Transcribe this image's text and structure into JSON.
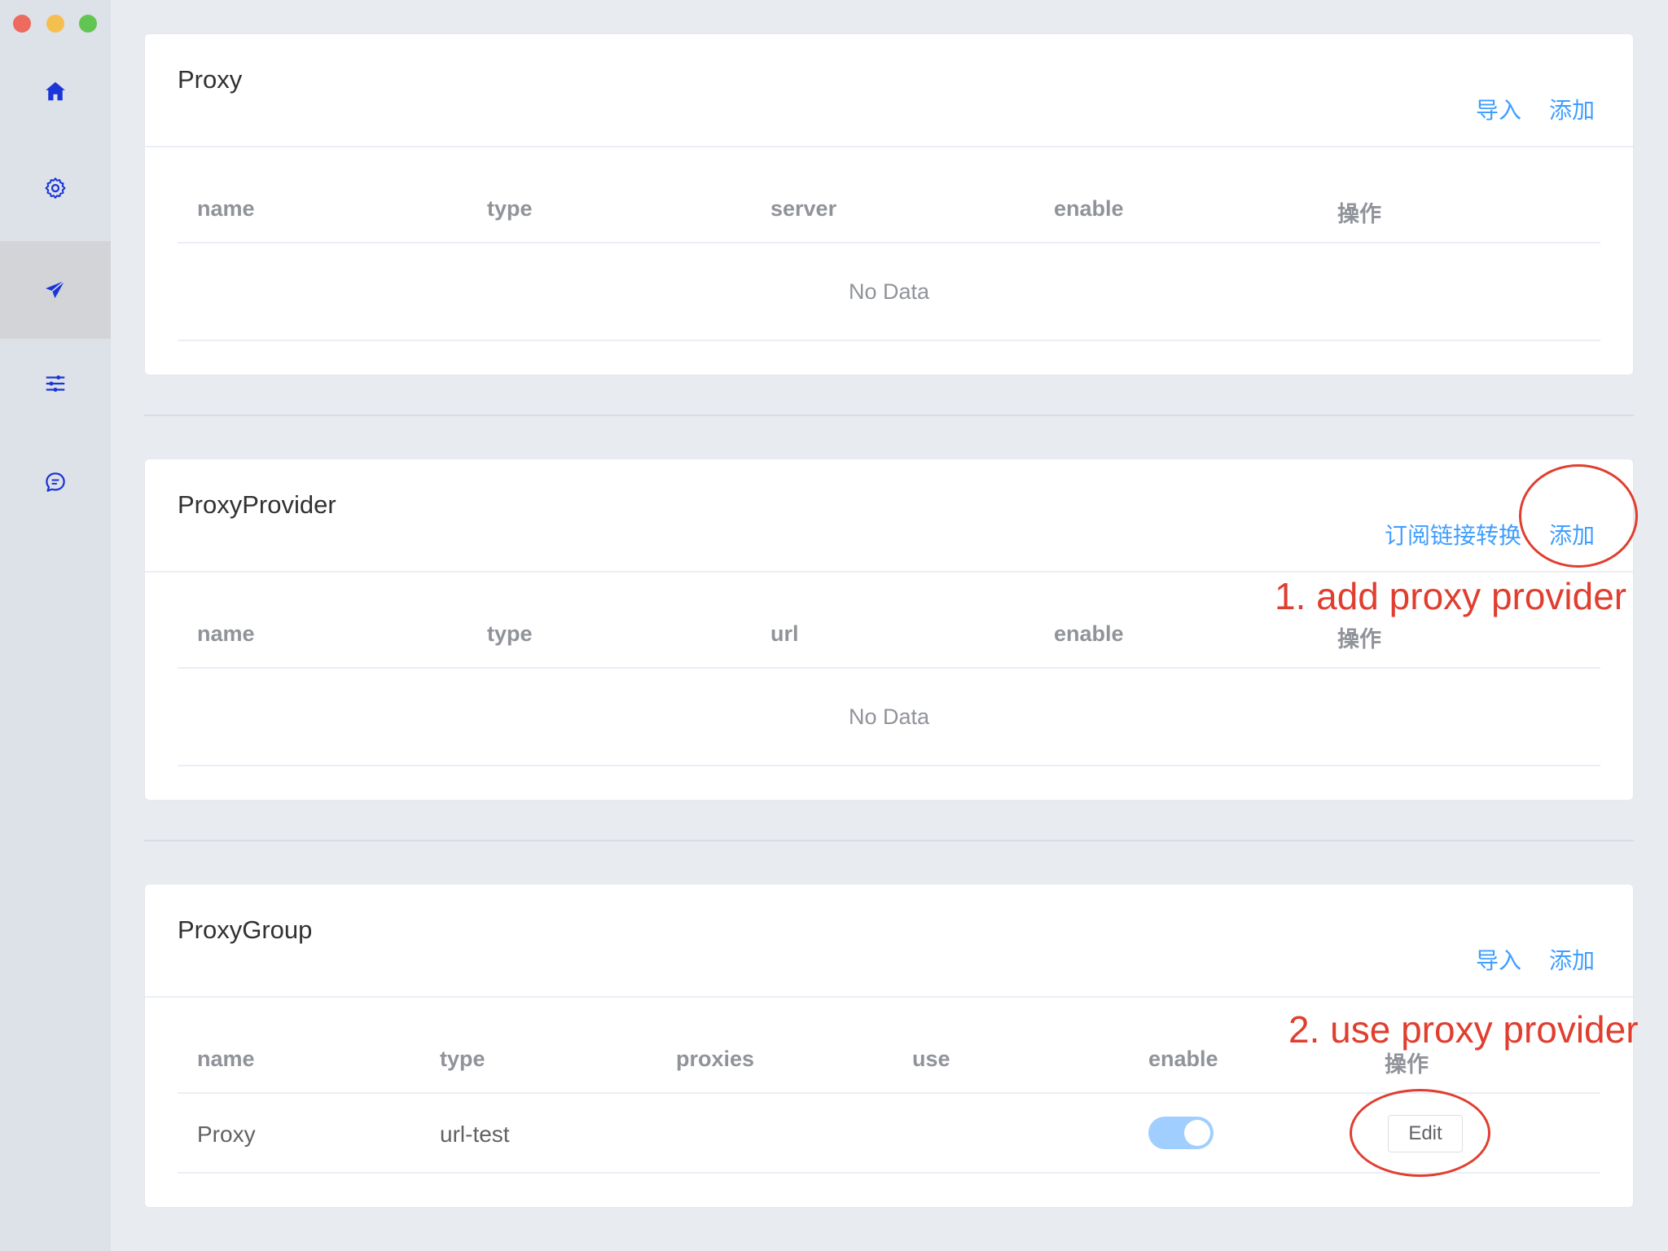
{
  "window": {
    "traffic_lights": {
      "close": "#ed6a5e",
      "minimize": "#f5bf4f",
      "maximize": "#61c554"
    }
  },
  "sidebar": {
    "items": [
      {
        "icon": "home-icon"
      },
      {
        "icon": "gear-icon"
      },
      {
        "icon": "paper-plane-icon",
        "active": true
      },
      {
        "icon": "sliders-icon"
      },
      {
        "icon": "chat-icon"
      }
    ],
    "accent_color": "#1a35d8"
  },
  "proxy": {
    "title": "Proxy",
    "actions": {
      "import": "导入",
      "add": "添加"
    },
    "columns": {
      "name": "name",
      "type": "type",
      "server": "server",
      "enable": "enable",
      "ops": "操作"
    },
    "empty": "No Data"
  },
  "provider": {
    "title": "ProxyProvider",
    "actions": {
      "convert": "订阅链接转换",
      "add": "添加"
    },
    "columns": {
      "name": "name",
      "type": "type",
      "url": "url",
      "enable": "enable",
      "ops": "操作"
    },
    "empty": "No Data"
  },
  "group": {
    "title": "ProxyGroup",
    "actions": {
      "import": "导入",
      "add": "添加"
    },
    "columns": {
      "name": "name",
      "type": "type",
      "proxies": "proxies",
      "use": "use",
      "enable": "enable",
      "ops": "操作"
    },
    "rows": [
      {
        "name": "Proxy",
        "type": "url-test",
        "proxies": "",
        "use": "",
        "enable": true,
        "edit": "Edit"
      }
    ]
  },
  "annotations": {
    "step1": "1. add proxy provider",
    "step2": "2. use  proxy provider",
    "color": "#e03e2f"
  },
  "colors": {
    "link": "#409eff",
    "toggle_on": "#a0cfff"
  }
}
